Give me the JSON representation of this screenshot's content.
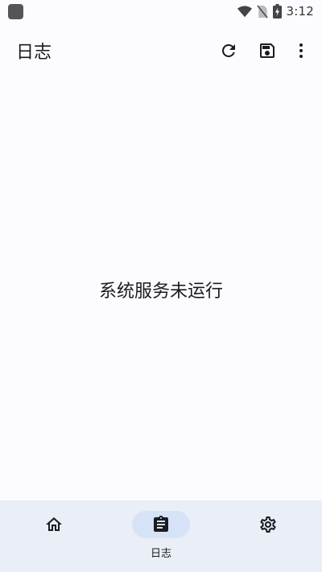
{
  "status_bar": {
    "time": "3:12",
    "icons": [
      "app-notification-icon",
      "wifi-icon",
      "no-sim-icon",
      "battery-charging-icon"
    ]
  },
  "top_bar": {
    "title": "日志",
    "actions": [
      "refresh-icon",
      "save-icon",
      "more-vert-icon"
    ]
  },
  "main": {
    "message": "系统服务未运行"
  },
  "bottom_nav": {
    "items": [
      {
        "icon": "home-icon",
        "label": "",
        "active": false
      },
      {
        "icon": "clipboard-icon",
        "label": "日志",
        "active": true
      },
      {
        "icon": "settings-icon",
        "label": "",
        "active": false
      }
    ]
  },
  "colors": {
    "background": "#fcfbff",
    "nav_background": "#e9eef7",
    "active_indicator": "#d6e3f7",
    "text": "#1b1b1f"
  }
}
